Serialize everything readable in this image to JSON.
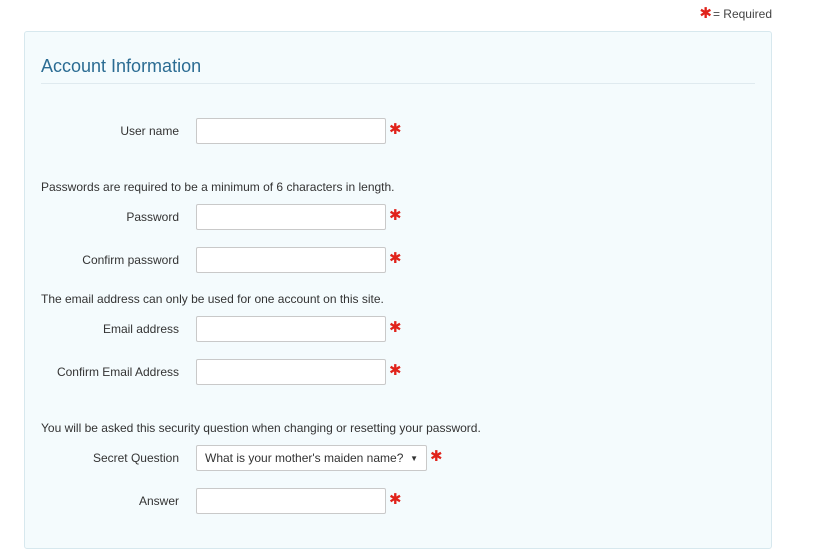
{
  "legend": {
    "text": "= Required"
  },
  "panel": {
    "title": "Account Information",
    "fields": {
      "username": {
        "label": "User name",
        "value": ""
      },
      "password_note": "Passwords are required to be a minimum of 6 characters in length.",
      "password": {
        "label": "Password",
        "value": ""
      },
      "confirm_password": {
        "label": "Confirm password",
        "value": ""
      },
      "email_note": "The email address can only be used for one account on this site.",
      "email": {
        "label": "Email address",
        "value": ""
      },
      "confirm_email": {
        "label": "Confirm Email Address",
        "value": ""
      },
      "security_note": "You will be asked this security question when changing or resetting your password.",
      "secret_question": {
        "label": "Secret Question",
        "selected": "What is your mother's maiden name?"
      },
      "answer": {
        "label": "Answer",
        "value": ""
      }
    }
  },
  "colors": {
    "required": "#e0231b",
    "title": "#2b6c93",
    "panel_bg": "#f4fbfd"
  }
}
